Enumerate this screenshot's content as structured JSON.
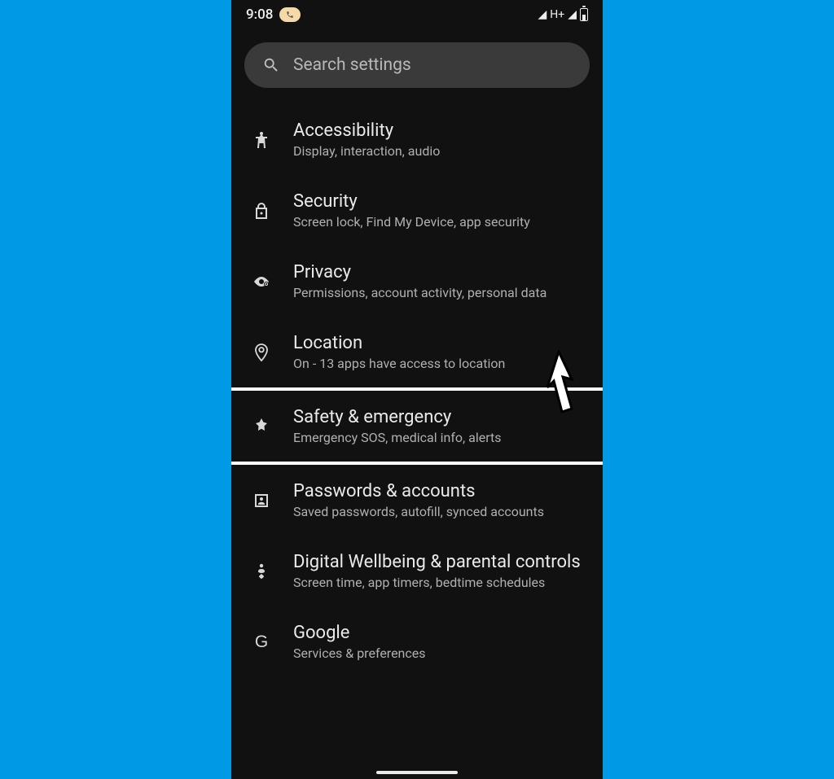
{
  "status": {
    "time": "9:08",
    "network": "H+"
  },
  "search": {
    "placeholder": "Search settings"
  },
  "settings": [
    {
      "key": "accessibility",
      "title": "Accessibility",
      "subtitle": "Display, interaction, audio",
      "icon": "accessibility"
    },
    {
      "key": "security",
      "title": "Security",
      "subtitle": "Screen lock, Find My Device, app security",
      "icon": "lock"
    },
    {
      "key": "privacy",
      "title": "Privacy",
      "subtitle": "Permissions, account activity, personal data",
      "icon": "eye"
    },
    {
      "key": "location",
      "title": "Location",
      "subtitle": "On - 13 apps have access to location",
      "icon": "pin"
    },
    {
      "key": "safety",
      "title": "Safety & emergency",
      "subtitle": "Emergency SOS, medical info, alerts",
      "icon": "medical"
    },
    {
      "key": "passwords",
      "title": "Passwords & accounts",
      "subtitle": "Saved passwords, autofill, synced accounts",
      "icon": "account"
    },
    {
      "key": "wellbeing",
      "title": "Digital Wellbeing & parental controls",
      "subtitle": "Screen time, app timers, bedtime schedules",
      "icon": "heart"
    },
    {
      "key": "google",
      "title": "Google",
      "subtitle": "Services & preferences",
      "icon": "google"
    }
  ],
  "highlighted_index": 4
}
